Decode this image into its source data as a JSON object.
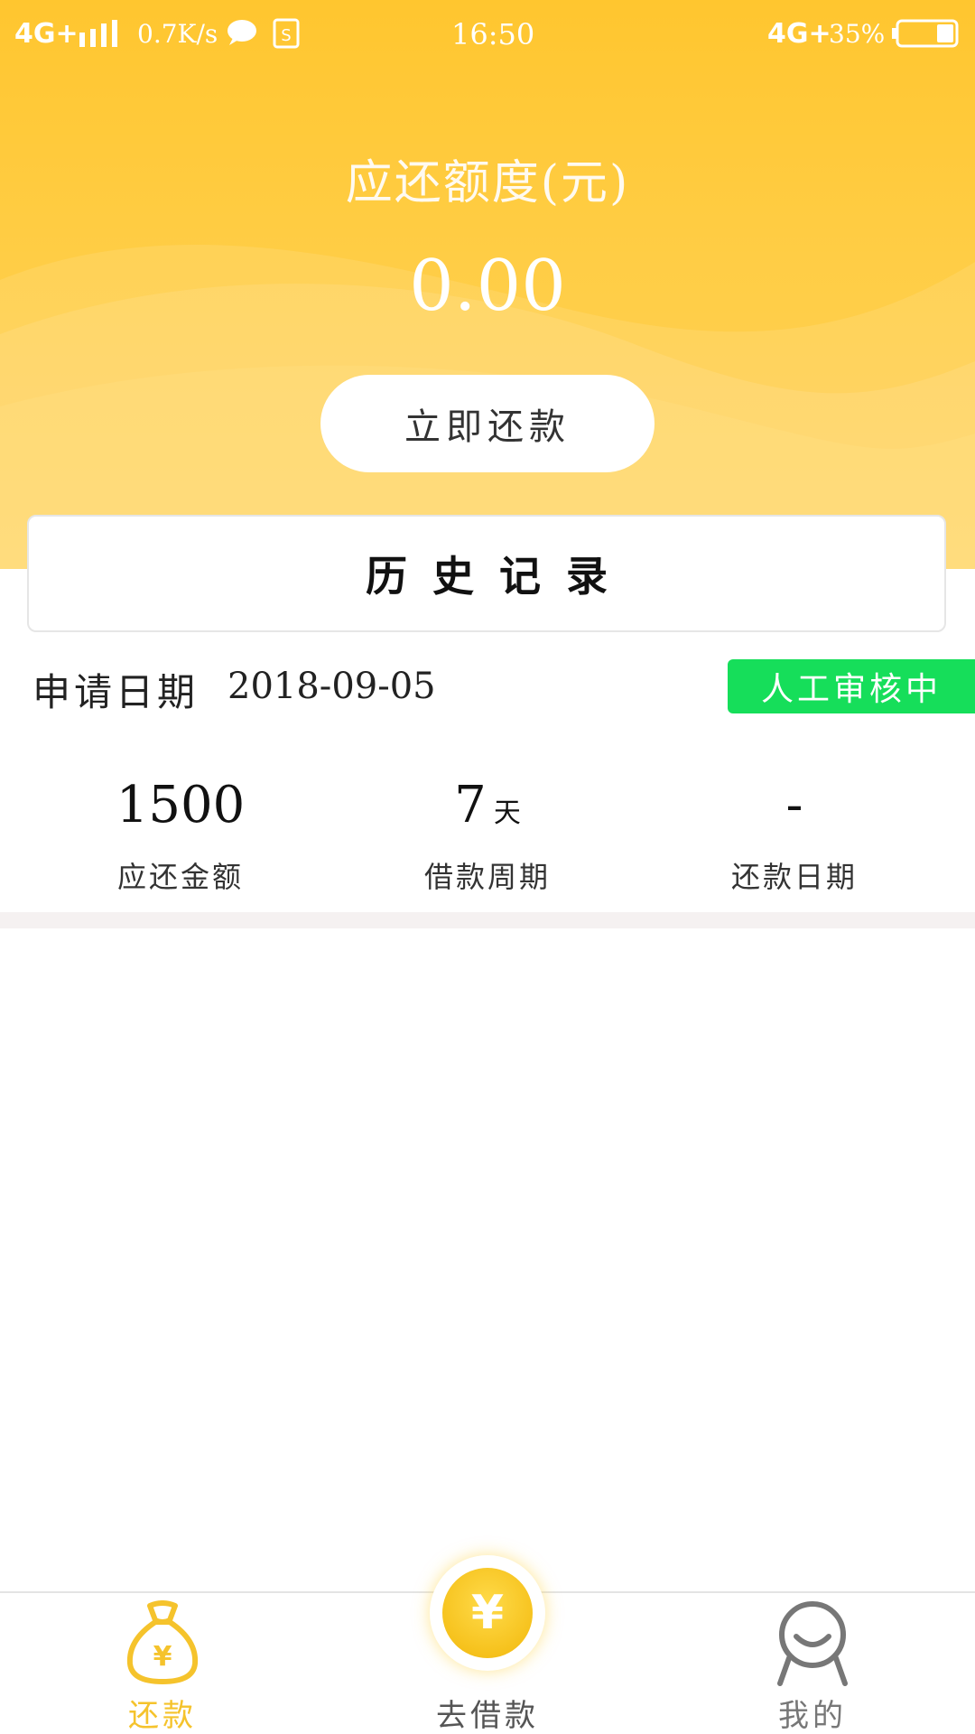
{
  "status_bar": {
    "network_left": "4G+",
    "speed": "0.7K/s",
    "time": "16:50",
    "network_right": "4G+",
    "battery_percent": "35%"
  },
  "header": {
    "amount_title": "应还额度(元)",
    "amount_value": "0.00",
    "repay_button": "立即还款"
  },
  "history": {
    "title": "历史记录"
  },
  "record": {
    "date_label": "申请日期",
    "date_value": "2018-09-05",
    "status": "人工审核中",
    "stats": [
      {
        "value": "1500",
        "unit": "",
        "label": "应还金额"
      },
      {
        "value": "7",
        "unit": "天",
        "label": "借款周期"
      },
      {
        "value": "-",
        "unit": "",
        "label": "还款日期"
      }
    ]
  },
  "bottom_nav": {
    "items": [
      {
        "label": "还款",
        "icon": "money-bag-icon",
        "active": true
      },
      {
        "label": "去借款",
        "icon": "yuan-coin-icon",
        "active": false
      },
      {
        "label": "我的",
        "icon": "user-icon",
        "active": false
      }
    ],
    "center_symbol": "¥"
  },
  "colors": {
    "header_yellow": "#ffc62f",
    "accent_yellow": "#f5c32c",
    "status_green": "#16de5a"
  }
}
